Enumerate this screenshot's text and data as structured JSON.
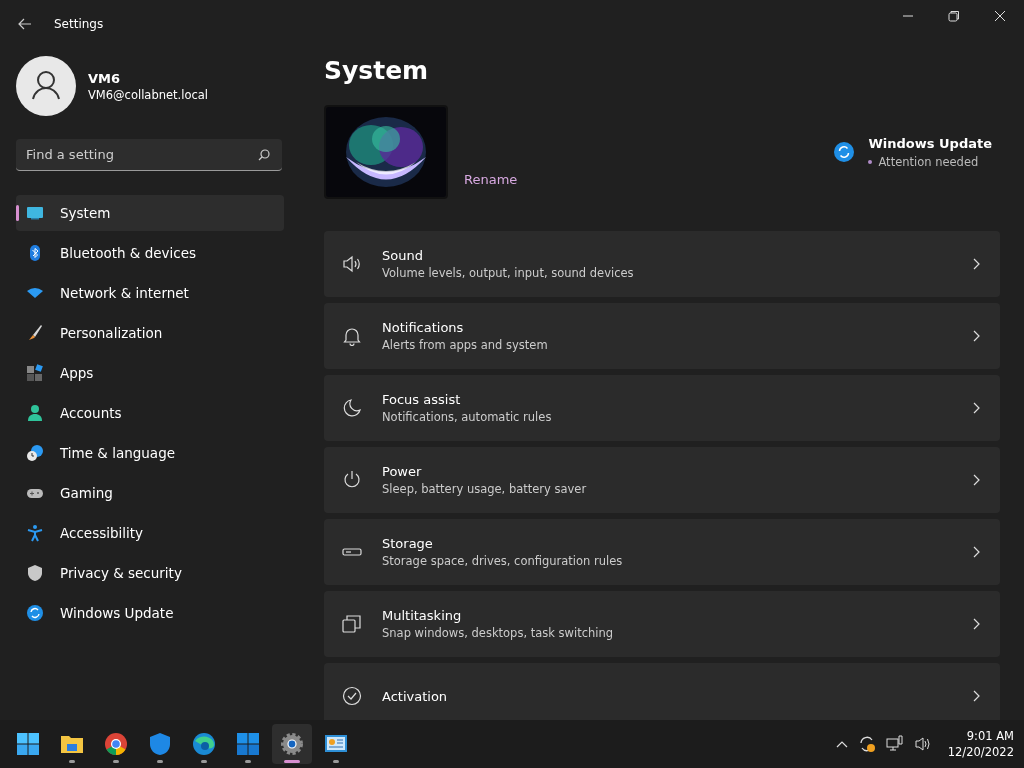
{
  "window": {
    "title": "Settings"
  },
  "account": {
    "name": "VM6",
    "email": "VM6@collabnet.local"
  },
  "search": {
    "placeholder": "Find a setting"
  },
  "nav": [
    {
      "kind": "system",
      "label": "System",
      "selected": true
    },
    {
      "kind": "bluetooth",
      "label": "Bluetooth & devices",
      "selected": false
    },
    {
      "kind": "network",
      "label": "Network & internet",
      "selected": false
    },
    {
      "kind": "personalization",
      "label": "Personalization",
      "selected": false
    },
    {
      "kind": "apps",
      "label": "Apps",
      "selected": false
    },
    {
      "kind": "accounts",
      "label": "Accounts",
      "selected": false
    },
    {
      "kind": "time",
      "label": "Time & language",
      "selected": false
    },
    {
      "kind": "gaming",
      "label": "Gaming",
      "selected": false
    },
    {
      "kind": "accessibility",
      "label": "Accessibility",
      "selected": false
    },
    {
      "kind": "privacy",
      "label": "Privacy & security",
      "selected": false
    },
    {
      "kind": "update",
      "label": "Windows Update",
      "selected": false
    }
  ],
  "page": {
    "title": "System",
    "rename": "Rename",
    "update": {
      "title": "Windows Update",
      "status": "Attention needed"
    }
  },
  "cards": [
    {
      "kind": "sound",
      "title": "Sound",
      "subtitle": "Volume levels, output, input, sound devices"
    },
    {
      "kind": "notifications",
      "title": "Notifications",
      "subtitle": "Alerts from apps and system"
    },
    {
      "kind": "focus",
      "title": "Focus assist",
      "subtitle": "Notifications, automatic rules"
    },
    {
      "kind": "power",
      "title": "Power",
      "subtitle": "Sleep, battery usage, battery saver"
    },
    {
      "kind": "storage",
      "title": "Storage",
      "subtitle": "Storage space, drives, configuration rules"
    },
    {
      "kind": "multitasking",
      "title": "Multitasking",
      "subtitle": "Snap windows, desktops, task switching"
    },
    {
      "kind": "activation",
      "title": "Activation"
    }
  ],
  "taskbar": [
    {
      "kind": "start",
      "running": false,
      "selected": false
    },
    {
      "kind": "explorer",
      "running": true,
      "selected": false
    },
    {
      "kind": "chrome",
      "running": true,
      "selected": false
    },
    {
      "kind": "shield",
      "running": true,
      "selected": false
    },
    {
      "kind": "edge",
      "running": true,
      "selected": false
    },
    {
      "kind": "store",
      "running": true,
      "selected": false
    },
    {
      "kind": "settings",
      "running": true,
      "selected": true
    },
    {
      "kind": "panel",
      "running": true,
      "selected": false
    }
  ],
  "clock": {
    "time": "9:01 AM",
    "date": "12/20/2022"
  }
}
